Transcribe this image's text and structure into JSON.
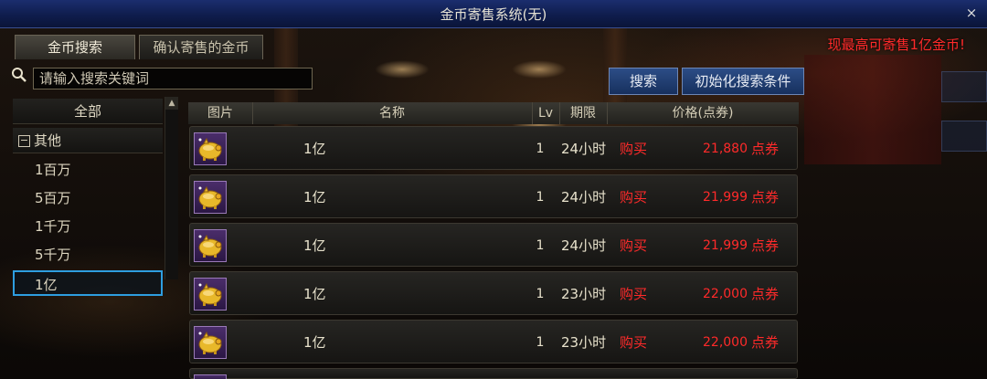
{
  "window": {
    "title": "金币寄售系统(无)",
    "close_glyph": "×"
  },
  "tabs": [
    {
      "label": "金币搜索",
      "active": true
    },
    {
      "label": "确认寄售的金币",
      "active": false
    }
  ],
  "promo_text": "现最高可寄售1亿金币!",
  "search": {
    "placeholder": "请输入搜索关键词",
    "value": ""
  },
  "buttons": {
    "search": "搜索",
    "reset": "初始化搜索条件"
  },
  "categories": {
    "all": "全部",
    "group": {
      "toggle": "−",
      "label": "其他"
    },
    "items": [
      "1百万",
      "5百万",
      "1千万",
      "5千万",
      "1亿"
    ],
    "selected": "1亿"
  },
  "table": {
    "headers": {
      "image": "图片",
      "name": "名称",
      "lv": "Lv",
      "duration": "期限",
      "price": "价格(点券)"
    },
    "rows": [
      {
        "icon": "gold-pig-icon",
        "name": "1亿",
        "lv": "1",
        "duration": "24小时",
        "action": "购买",
        "price": "21,880",
        "unit": "点券"
      },
      {
        "icon": "gold-pig-icon",
        "name": "1亿",
        "lv": "1",
        "duration": "24小时",
        "action": "购买",
        "price": "21,999",
        "unit": "点券"
      },
      {
        "icon": "gold-pig-icon",
        "name": "1亿",
        "lv": "1",
        "duration": "24小时",
        "action": "购买",
        "price": "21,999",
        "unit": "点券"
      },
      {
        "icon": "gold-pig-icon",
        "name": "1亿",
        "lv": "1",
        "duration": "23小时",
        "action": "购买",
        "price": "22,000",
        "unit": "点券"
      },
      {
        "icon": "gold-pig-icon",
        "name": "1亿",
        "lv": "1",
        "duration": "23小时",
        "action": "购买",
        "price": "22,000",
        "unit": "点券"
      }
    ]
  },
  "colors": {
    "accent_red": "#ff2a2a",
    "title_blue": "#1b2e6e",
    "selected_border": "#2e9ee0"
  }
}
